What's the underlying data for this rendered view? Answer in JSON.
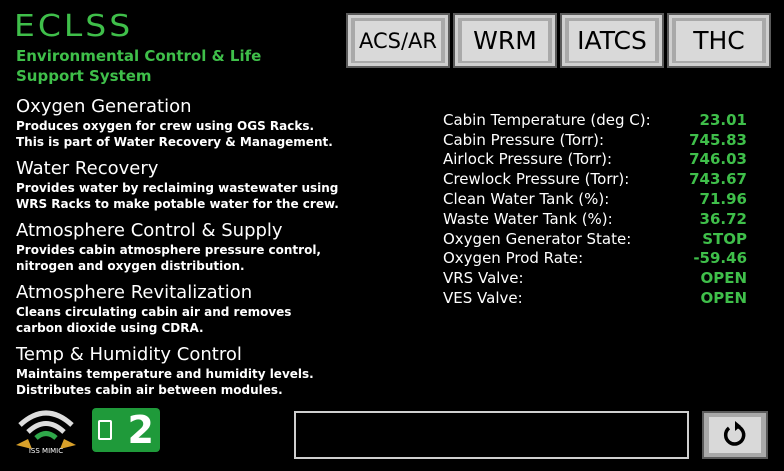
{
  "header": {
    "title": "ECLSS",
    "subtitle": "Environmental Control & Life Support System"
  },
  "nav": {
    "tabs": [
      {
        "label": "ACS/AR"
      },
      {
        "label": "WRM"
      },
      {
        "label": "IATCS"
      },
      {
        "label": "THC"
      }
    ]
  },
  "subsystems": [
    {
      "title": "Oxygen Generation",
      "line1": "Produces oxygen for crew using OGS Racks.",
      "line2": "This is part of  Water Recovery & Management."
    },
    {
      "title": "Water Recovery",
      "line1": "Provides water by reclaiming wastewater using",
      "line2": "WRS Racks to make potable water for the crew."
    },
    {
      "title": "Atmosphere Control & Supply",
      "line1": "Provides cabin atmosphere pressure control,",
      "line2": "nitrogen and oxygen distribution."
    },
    {
      "title": "Atmosphere Revitalization",
      "line1": "Cleans circulating cabin air and removes",
      "line2": "carbon dioxide using CDRA."
    },
    {
      "title": "Temp & Humidity Control",
      "line1": "Maintains temperature and humidity levels.",
      "line2": "Distributes cabin air between modules."
    }
  ],
  "telemetry": [
    {
      "label": "Cabin Temperature (deg C):",
      "value": "23.01"
    },
    {
      "label": "Cabin Pressure (Torr):",
      "value": "745.83"
    },
    {
      "label": "Airlock Pressure (Torr):",
      "value": "746.03"
    },
    {
      "label": "Crewlock Pressure (Torr):",
      "value": "743.67"
    },
    {
      "label": "Clean Water Tank (%):",
      "value": "71.96"
    },
    {
      "label": "Waste Water Tank (%):",
      "value": "36.72"
    },
    {
      "label": "Oxygen Generator State:",
      "value": "STOP"
    },
    {
      "label": "Oxygen Prod Rate:",
      "value": "-59.46"
    },
    {
      "label": "VRS Valve:",
      "value": "OPEN"
    },
    {
      "label": "VES Valve:",
      "value": "OPEN"
    }
  ],
  "footer": {
    "wifi_logo_text": "ISS MIMIC",
    "arduino_count": "2",
    "message": ""
  },
  "icons": {
    "wifi": "wifi-icon",
    "arduino": "arduino-icon",
    "refresh": "refresh-icon"
  },
  "colors": {
    "accent": "#3fbf4a",
    "background": "#000000",
    "button": "#d9d9d9"
  }
}
